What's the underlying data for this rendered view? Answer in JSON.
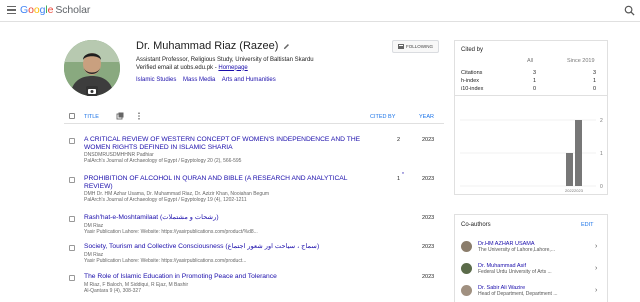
{
  "header": {
    "brand": [
      "G",
      "o",
      "o",
      "g",
      "l",
      "e"
    ],
    "product": "Scholar"
  },
  "profile": {
    "name": "Dr. Muhammad Riaz (Razee)",
    "affiliation": "Assistant Professor, Religious Study, University of Baltistan Skardu",
    "verified_email": "Verified email at uobs.edu.pk -",
    "homepage": "Homepage",
    "interests": [
      "Islamic Studies",
      "Mass Media",
      "Arts and Humanities"
    ],
    "follow_label": "FOLLOWING"
  },
  "table": {
    "title_col": "TITLE",
    "cited_by_col": "CITED BY",
    "year_col": "YEAR",
    "rows": [
      {
        "title": "A CRITICAL REVIEW OF WESTERN CONCEPT OF WOMEN'S INDEPENDENCE AND THE WOMEN RIGHTS DEFINED IN ISLAMIC SHARIA",
        "authors": "DNSDMRUSDMHHNR Padhiar",
        "venue": "PalArch's Journal of Archaeology of Egypt / Egyptology 20 (2), 566-595",
        "cited": "2",
        "star": "",
        "year": "2023"
      },
      {
        "title": "PROHIBITION OF ALCOHOL IN QURAN AND BIBLE (A RESEARCH AND ANALYTICAL REVIEW)",
        "authors": "DMH Dr. HM Azhar Usama, Dr. Muhammad Riaz, Dr. Azizir Khan, Nooiahan Begum",
        "venue": "PalArch's Journal of Archaeology of Egypt / Egyptology 19 (4), 1202-1211",
        "cited": "1",
        "star": "*",
        "year": "2023"
      },
      {
        "title": "Rash'hat-e-Moshtamilaat (رشحات و مشتملات)",
        "authors": "DM Riaz",
        "venue": "Yasir Publication Lahore: Website: https://yasirpublications.com/product/%d8...",
        "cited": "",
        "star": "",
        "year": "2023"
      },
      {
        "title": "Society, Tourism and Collective Consciousness (سماج ، سیاحت اور شعور اجتماع)",
        "authors": "DM Riaz",
        "venue": "Yasir Publication Lahore: Website: https://yasirpublications.com/product...",
        "cited": "",
        "star": "",
        "year": "2023"
      },
      {
        "title": "The Role of Islamic Education in Promoting Peace and Tolerance",
        "authors": "M Riaz, F Baloch, M Siddiqui, R Ejaz, M Bashir",
        "venue": "Al-Qantara 9 (4), 308-327",
        "cited": "",
        "star": "",
        "year": "2023"
      }
    ]
  },
  "cited_by": {
    "title": "Cited by",
    "col_all": "All",
    "col_since": "Since 2019",
    "rows": [
      {
        "label": "Citations",
        "all": "3",
        "since": "3"
      },
      {
        "label": "h-index",
        "all": "1",
        "since": "1"
      },
      {
        "label": "i10-index",
        "all": "0",
        "since": "0"
      }
    ]
  },
  "chart_data": {
    "type": "bar",
    "categories": [
      "2022",
      "2023"
    ],
    "values": [
      1,
      2
    ],
    "ylim": [
      0,
      2
    ],
    "yticks": [
      "2",
      "1",
      "0"
    ]
  },
  "coauthors": {
    "title": "Co-authors",
    "edit_label": "EDIT",
    "items": [
      {
        "name": "Dr.HM AZHAR USAMA",
        "affiliation": "The University of Lahore,Lahore,..."
      },
      {
        "name": "Dr. Muhammad Asif",
        "affiliation": "Federal Urdu University of Arts ..."
      },
      {
        "name": "Dr. Sabir Ali Wazire",
        "affiliation": "Head of Department, Department ..."
      }
    ]
  },
  "colors": {
    "link": "#1a0dab",
    "accent": "#1a73e8",
    "bar": "#777777"
  }
}
